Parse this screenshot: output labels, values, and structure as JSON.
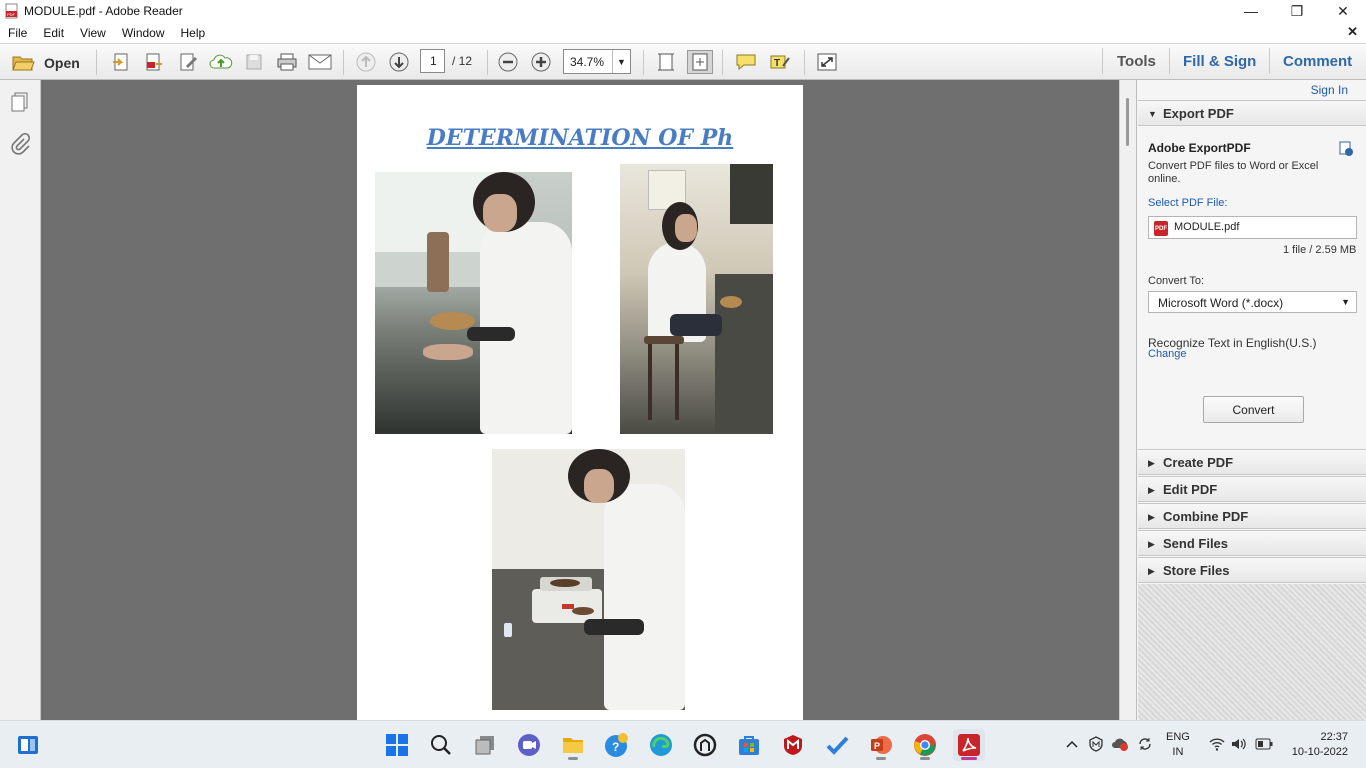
{
  "window": {
    "title": "MODULE.pdf - Adobe Reader"
  },
  "menu": {
    "items": [
      "File",
      "Edit",
      "View",
      "Window",
      "Help"
    ]
  },
  "toolbar": {
    "open_label": "Open",
    "page_current": "1",
    "page_total": "/ 12",
    "zoom": "34.7%",
    "tools_label": "Tools",
    "fill_sign_label": "Fill & Sign",
    "comment_label": "Comment"
  },
  "document": {
    "title": "DETERMINATION OF Ph"
  },
  "right_panel": {
    "sign_in": "Sign In",
    "export_header": "Export PDF",
    "export_title": "Adobe ExportPDF",
    "export_desc": "Convert PDF files to Word or Excel online.",
    "select_file_label": "Select PDF File:",
    "file_name": "MODULE.pdf",
    "file_meta": "1 file / 2.59 MB",
    "convert_to_label": "Convert To:",
    "convert_to_value": "Microsoft Word (*.docx)",
    "recognize_text": "Recognize Text in English(U.S.)",
    "change_link": "Change",
    "convert_button": "Convert",
    "sections": [
      "Create PDF",
      "Edit PDF",
      "Combine PDF",
      "Send Files",
      "Store Files"
    ]
  },
  "taskbar": {
    "lang_top": "ENG",
    "lang_bottom": "IN",
    "time": "22:37",
    "date": "10-10-2022",
    "apps": [
      "start",
      "search",
      "task-view",
      "zoom",
      "file-explorer",
      "tips",
      "edge",
      "unknown",
      "store",
      "mcafee",
      "todo",
      "powerpoint",
      "chrome",
      "adobe-reader"
    ]
  },
  "colors": {
    "accent_blue": "#2e68a8",
    "doc_title": "#4a7cc3",
    "viewport_bg": "#6f6f6f",
    "adobe_red": "#c8252a"
  }
}
